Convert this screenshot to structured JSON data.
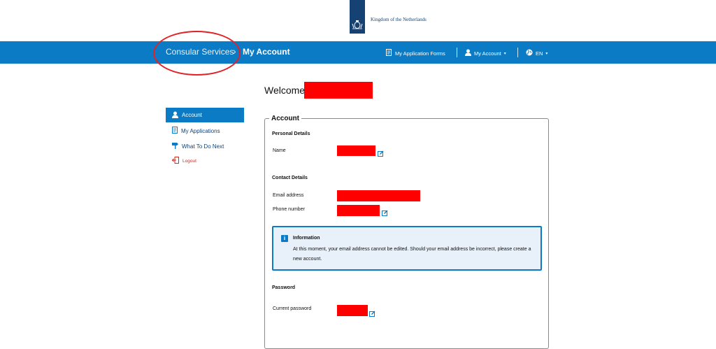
{
  "header": {
    "logo_text": "Kingdom of the Netherlands",
    "emblem_icon": "royal-coat-of-arms-icon"
  },
  "nav": {
    "breadcrumb": [
      "Consular Services",
      "My Account"
    ],
    "breadcrumb_separator": "›",
    "items": [
      {
        "label": "My Application Forms",
        "icon": "form-icon"
      },
      {
        "label": "My Account",
        "icon": "user-icon",
        "dropdown": true
      },
      {
        "label": "EN",
        "icon": "globe-icon",
        "dropdown": true
      }
    ],
    "bg_color": "#0a7bc4"
  },
  "welcome": {
    "label": "Welcome"
  },
  "sidebar": {
    "items": [
      {
        "label": "Account",
        "icon": "user-icon",
        "active": true
      },
      {
        "label": "My Applications",
        "icon": "document-icon"
      },
      {
        "label": "What To Do Next",
        "icon": "signpost-icon"
      },
      {
        "label": "Logout",
        "icon": "logout-icon",
        "color": "#d52b1e"
      }
    ]
  },
  "account": {
    "title": "Account",
    "personal": {
      "heading": "Personal Details",
      "name_label": "Name"
    },
    "contact": {
      "heading": "Contact Details",
      "email_label": "Email address",
      "phone_label": "Phone number"
    },
    "info": {
      "title": "Information",
      "body": "At this moment, your email address cannot be edited. Should your email address be incorrect, please create a new account."
    },
    "password": {
      "heading": "Password",
      "current_label": "Current password"
    }
  },
  "annotation_color": "#e32227",
  "redaction_color": "#ff0000"
}
